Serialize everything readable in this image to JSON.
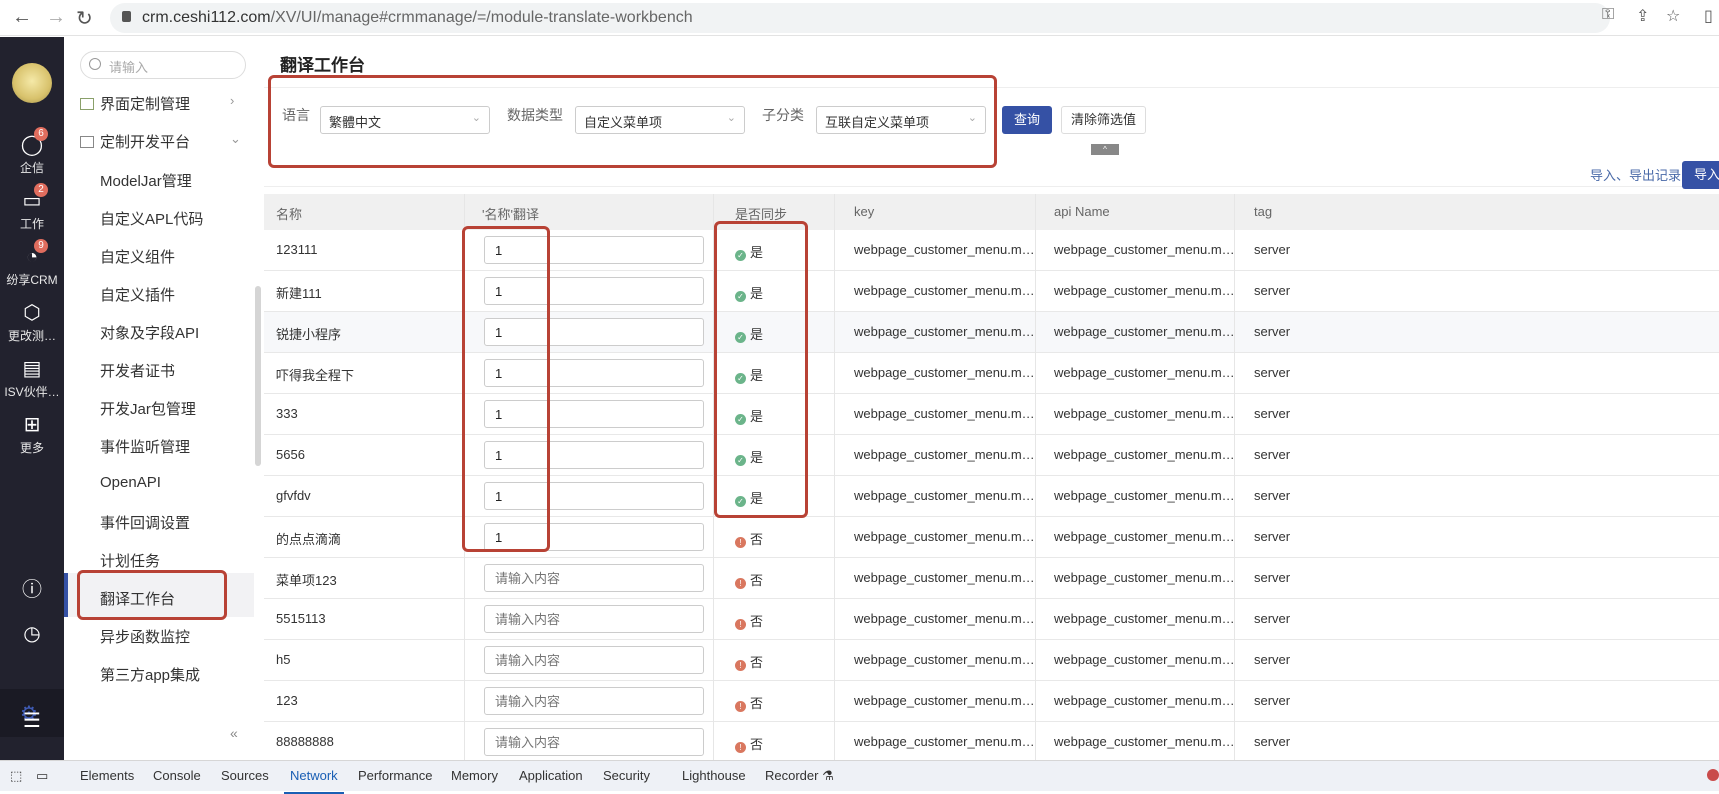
{
  "browser": {
    "url_host": "crm.ceshi112.com",
    "url_path": "/XV/UI/manage#crmmanage/=/module-translate-workbench",
    "icons": [
      "back-icon",
      "forward-icon",
      "reload-icon",
      "lock-icon",
      "key-icon",
      "share-icon",
      "star-icon",
      "sidebar-icon"
    ]
  },
  "rail": {
    "items": [
      {
        "label": "企信",
        "icon": "chat-icon",
        "badge": "6"
      },
      {
        "label": "工作",
        "icon": "briefcase-icon",
        "badge": "2"
      },
      {
        "label": "纷享CRM",
        "icon": "pie-chart-icon",
        "badge": "9"
      },
      {
        "label": "更改测…",
        "icon": "cube-icon",
        "badge": ""
      },
      {
        "label": "ISV伙伴…",
        "icon": "document-icon",
        "badge": ""
      },
      {
        "label": "更多",
        "icon": "grid-icon",
        "badge": ""
      }
    ]
  },
  "menu": {
    "search_placeholder": "请输入",
    "groups": [
      {
        "label": "界面定制管理"
      },
      {
        "label": "定制开发平台"
      }
    ],
    "items": [
      "ModelJar管理",
      "自定义APL代码",
      "自定义组件",
      "自定义插件",
      "对象及字段API",
      "开发者证书",
      "开发Jar包管理",
      "事件监听管理",
      "OpenAPI",
      "事件回调设置",
      "计划任务",
      "翻译工作台",
      "异步函数监控",
      "第三方app集成"
    ],
    "selected": "翻译工作台",
    "collapse": "«"
  },
  "page": {
    "title": "翻译工作台",
    "filters": {
      "language_label": "语言",
      "language_value": "繁體中文",
      "datatype_label": "数据类型",
      "datatype_value": "自定义菜单项",
      "subtype_label": "子分类",
      "subtype_value": "互联自定义菜单项"
    },
    "query_button": "查询",
    "clear_button": "清除筛选值",
    "toggle": "^",
    "io_record_link": "导入、导出记录",
    "import_button": "导入"
  },
  "table": {
    "columns": [
      "名称",
      "'名称'翻译",
      "是否同步",
      "key",
      "api Name",
      "tag"
    ],
    "placeholder": "请输入内容",
    "rows": [
      {
        "name": "123111",
        "translation": "1",
        "synced": "是",
        "ok": true,
        "key": "webpage_customer_menu.m…",
        "api": "webpage_customer_menu.m…",
        "tag": "server"
      },
      {
        "name": "新建111",
        "translation": "1",
        "synced": "是",
        "ok": true,
        "key": "webpage_customer_menu.m…",
        "api": "webpage_customer_menu.m…",
        "tag": "server"
      },
      {
        "name": "锐捷小程序",
        "translation": "1",
        "synced": "是",
        "ok": true,
        "key": "webpage_customer_menu.m…",
        "api": "webpage_customer_menu.m…",
        "tag": "server"
      },
      {
        "name": "吓得我全程下",
        "translation": "1",
        "synced": "是",
        "ok": true,
        "key": "webpage_customer_menu.m…",
        "api": "webpage_customer_menu.m…",
        "tag": "server"
      },
      {
        "name": "333",
        "translation": "1",
        "synced": "是",
        "ok": true,
        "key": "webpage_customer_menu.m…",
        "api": "webpage_customer_menu.m…",
        "tag": "server"
      },
      {
        "name": "5656",
        "translation": "1",
        "synced": "是",
        "ok": true,
        "key": "webpage_customer_menu.m…",
        "api": "webpage_customer_menu.m…",
        "tag": "server"
      },
      {
        "name": "gfvfdv",
        "translation": "1",
        "synced": "是",
        "ok": true,
        "key": "webpage_customer_menu.m…",
        "api": "webpage_customer_menu.m…",
        "tag": "server"
      },
      {
        "name": "的点点滴滴",
        "translation": "1",
        "synced": "否",
        "ok": false,
        "key": "webpage_customer_menu.m…",
        "api": "webpage_customer_menu.m…",
        "tag": "server"
      },
      {
        "name": "菜单项123",
        "translation": "",
        "synced": "否",
        "ok": false,
        "key": "webpage_customer_menu.m…",
        "api": "webpage_customer_menu.m…",
        "tag": "server"
      },
      {
        "name": "5515113",
        "translation": "",
        "synced": "否",
        "ok": false,
        "key": "webpage_customer_menu.m…",
        "api": "webpage_customer_menu.m…",
        "tag": "server"
      },
      {
        "name": "h5",
        "translation": "",
        "synced": "否",
        "ok": false,
        "key": "webpage_customer_menu.m…",
        "api": "webpage_customer_menu.m…",
        "tag": "server"
      },
      {
        "name": "123",
        "translation": "",
        "synced": "否",
        "ok": false,
        "key": "webpage_customer_menu.m…",
        "api": "webpage_customer_menu.m…",
        "tag": "server"
      },
      {
        "name": "88888888",
        "translation": "",
        "synced": "否",
        "ok": false,
        "key": "webpage_customer_menu.m…",
        "api": "webpage_customer_menu.m…",
        "tag": "server"
      }
    ]
  },
  "devtools": {
    "tabs": [
      "Elements",
      "Console",
      "Sources",
      "Network",
      "Performance",
      "Memory",
      "Application",
      "Security",
      "Lighthouse",
      "Recorder ⚗"
    ],
    "active": "Network"
  },
  "colors": {
    "primary": "#3551a5",
    "highlight_box": "#b84235",
    "ok": "#6bb48a",
    "warn": "#d9775f"
  }
}
